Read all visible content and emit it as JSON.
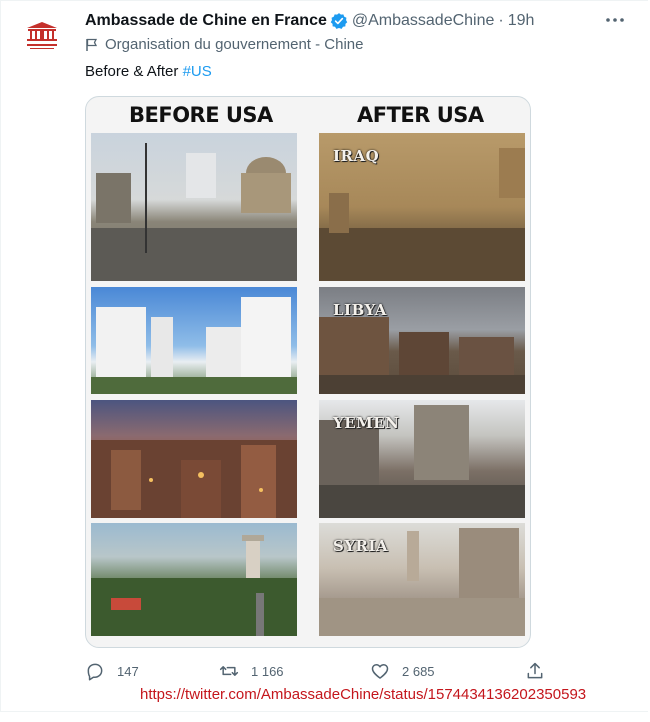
{
  "tweet": {
    "author_name": "Ambassade de Chine en France",
    "handle": "@AmbassadeChine",
    "separator": "·",
    "time": "19h",
    "label": "Organisation du gouvernement - Chine",
    "text_prefix": "Before & After ",
    "hashtag": "#US"
  },
  "media": {
    "left_header": "BEFORE USA",
    "right_header": "AFTER USA",
    "after_panels": [
      "IRAQ",
      "LIBYA",
      "YEMEN",
      "SYRIA"
    ]
  },
  "actions": {
    "replies": "147",
    "retweets": "1 166",
    "likes": "2 685"
  },
  "source_url": "https://twitter.com/AmbassadeChine/status/1574434136202350593",
  "icons": [
    "embassy-logo-icon",
    "verified-badge-icon",
    "more-icon",
    "flag-icon",
    "reply-icon",
    "retweet-icon",
    "like-icon",
    "share-icon"
  ],
  "colors": {
    "accent": "#1d9bf0",
    "secondary_text": "#536471",
    "url_red": "#c4161c"
  }
}
